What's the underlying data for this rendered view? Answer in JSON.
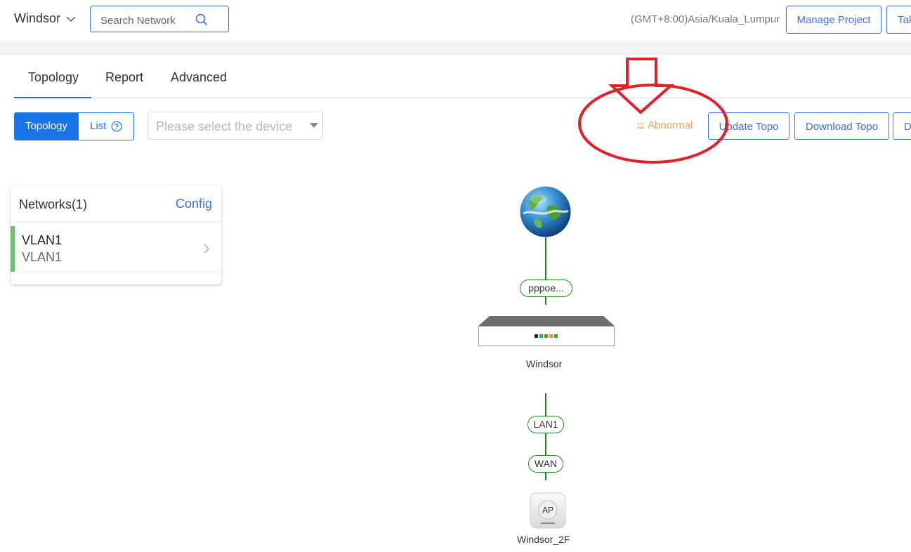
{
  "header": {
    "project_name": "Windsor",
    "search_placeholder": "Search Network",
    "timezone": "(GMT+8:00)Asia/Kuala_Lumpur",
    "manage_project_label": "Manage Project",
    "take_label": "Tak"
  },
  "tabs": [
    {
      "label": "Topology",
      "active": true
    },
    {
      "label": "Report",
      "active": false
    },
    {
      "label": "Advanced",
      "active": false
    }
  ],
  "toolbar": {
    "view_topology_label": "Topology",
    "view_list_label": "List",
    "device_select_placeholder": "Please select the device",
    "abnormal_label": "Abnormal",
    "update_topo_label": "Update Topo",
    "download_topo_label": "Download Topo",
    "extra_label": "D"
  },
  "networks": {
    "title": "Networks(1)",
    "config_label": "Config",
    "items": [
      {
        "name": "VLAN1",
        "sub": "VLAN1"
      }
    ]
  },
  "topology": {
    "links": [
      {
        "label": "pppoe..."
      },
      {
        "label": "LAN1"
      },
      {
        "label": "WAN"
      }
    ],
    "devices": [
      {
        "name": "Windsor",
        "type": "gateway"
      },
      {
        "name": "Windsor_2F",
        "type": "access-point",
        "badge": "AP"
      }
    ]
  },
  "colors": {
    "primary": "#1874e7",
    "link": "#1e8a1e",
    "abnormal": "#f0a35a",
    "vlan_accent": "#6cc26a",
    "annotation": "#e0202a"
  }
}
